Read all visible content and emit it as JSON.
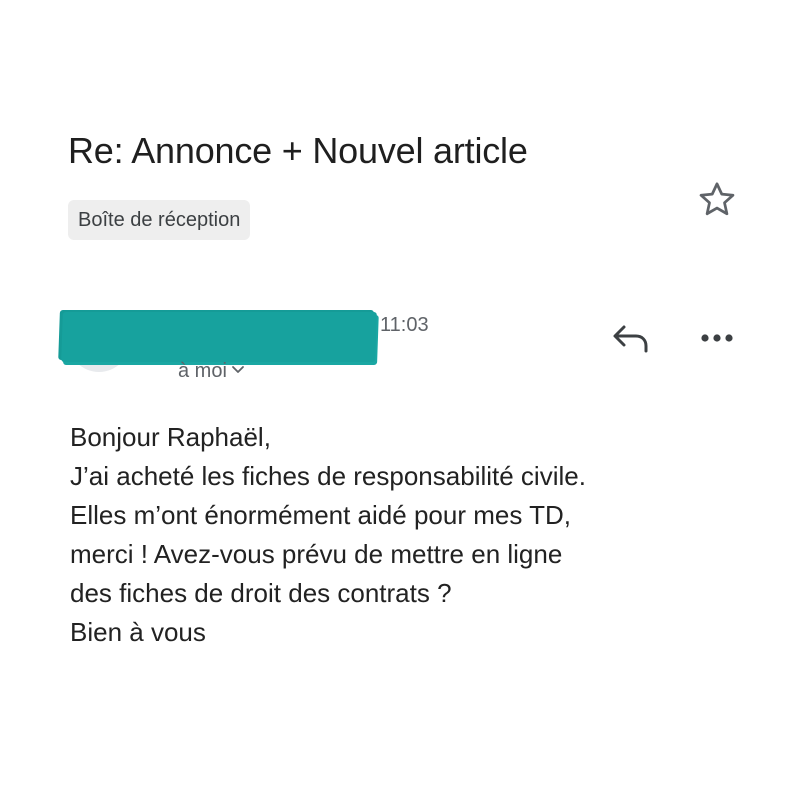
{
  "email": {
    "subject": "Re: Annonce + Nouvel article",
    "label": "Boîte de réception",
    "starred": false,
    "sender": {
      "name": "",
      "redacted": true,
      "redaction_color": "#17a29e"
    },
    "time": "11:03",
    "recipient": "à moi",
    "body_lines": [
      "Bonjour Raphaël,",
      "J’ai acheté les fiches de responsabilité civile.",
      "Elles m’ont énormément aidé pour mes TD,",
      "merci ! Avez-vous prévu de mettre en ligne",
      "des fiches de droit des contrats ?",
      "Bien à vous"
    ]
  },
  "icons": {
    "star": "star-outline-icon",
    "reply": "reply-icon",
    "more": "more-horizontal-icon",
    "chevron": "chevron-down-icon"
  }
}
